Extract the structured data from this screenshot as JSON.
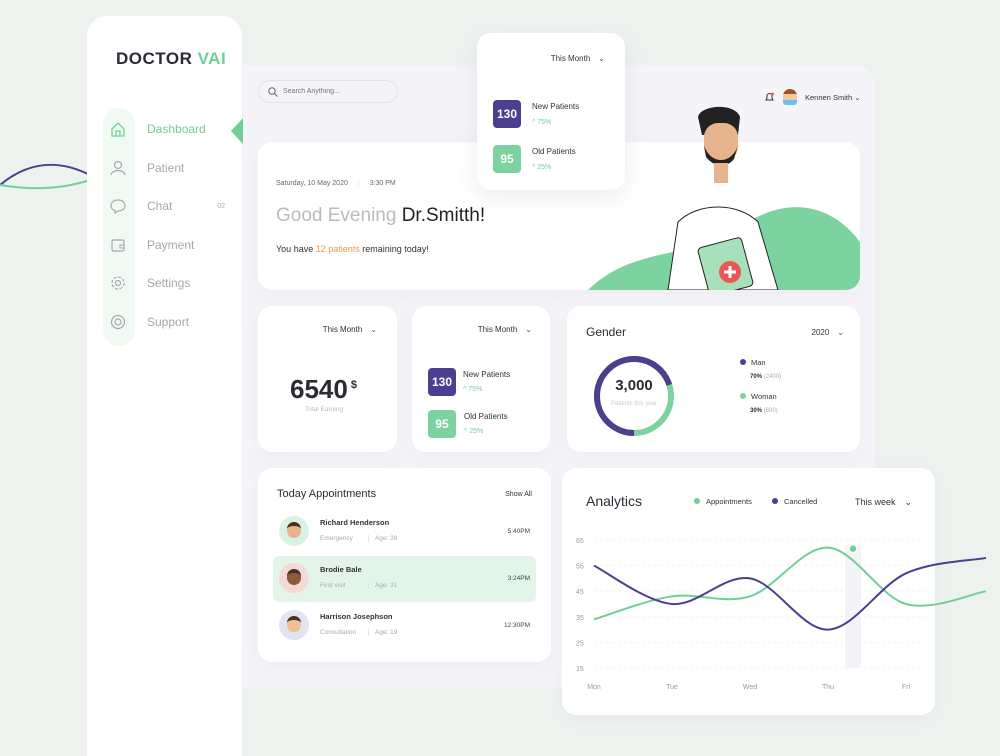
{
  "brand": {
    "name_part1": "DOCTOR",
    "name_part2": "VAI"
  },
  "sidebar": {
    "items": [
      {
        "label": "Dashboard",
        "icon": "home-icon",
        "active": true
      },
      {
        "label": "Patient",
        "icon": "user-icon"
      },
      {
        "label": "Chat",
        "icon": "chat-icon",
        "badge": "02"
      },
      {
        "label": "Payment",
        "icon": "wallet-icon"
      },
      {
        "label": "Settings",
        "icon": "gear-icon"
      },
      {
        "label": "Support",
        "icon": "lifebuoy-icon"
      }
    ]
  },
  "header": {
    "search_placeholder": "Search Anything...",
    "user_name": "Kennen Smith"
  },
  "floating_card": {
    "period": "This Month",
    "new_value": "130",
    "new_label": "New Patients",
    "new_pct": "75%",
    "old_value": "95",
    "old_label": "Old Patients",
    "old_pct": "25%"
  },
  "greeting": {
    "date": "Saturday, 10 May 2020",
    "time": "3:30 PM",
    "hello": "Good Evening ",
    "doctor": "Dr.Smitth!",
    "msg_pre": "You have ",
    "msg_highlight": "12 patients",
    "msg_post": " remaining today!"
  },
  "earning": {
    "period": "This Month",
    "value": "6540",
    "currency": "$",
    "label": "Total Earning"
  },
  "patients": {
    "period": "This Month",
    "new_value": "130",
    "new_label": "New Patients",
    "new_pct": "75%",
    "old_value": "95",
    "old_label": "Old Patients",
    "old_pct": "25%"
  },
  "gender": {
    "title": "Gender",
    "year": "2020",
    "total": "3,000",
    "total_label": "Patients this year",
    "man_label": "Man",
    "man_pct": "70%",
    "man_count": "(2400)",
    "woman_label": "Woman",
    "woman_pct": "30%",
    "woman_count": "(600)",
    "man_fraction": 0.7
  },
  "appointments": {
    "title": "Today Appointments",
    "show_all": "Show All",
    "items": [
      {
        "name": "Richard Henderson",
        "type": "Emergency",
        "age": "Age: 28",
        "time": "5:40PM"
      },
      {
        "name": "Brodie Bale",
        "type": "First visit",
        "age": "Age: 31",
        "time": "3:24PM",
        "highlight": true
      },
      {
        "name": "Harrison Josephson",
        "type": "Consultation",
        "age": "Age: 19",
        "time": "12:30PM"
      }
    ]
  },
  "colors": {
    "green": "#6fcf97",
    "purple": "#4b3f8f",
    "orange": "#f2994a"
  },
  "chart_data": {
    "type": "line",
    "title": "Analytics",
    "period": "This week",
    "categories": [
      "Mon",
      "Tue",
      "Wed",
      "Thu",
      "Fri"
    ],
    "yticks": [
      "65",
      "55",
      "45",
      "35",
      "25",
      "15"
    ],
    "ylim": [
      15,
      65
    ],
    "series": [
      {
        "name": "Appointments",
        "color": "#6fcf97",
        "values": [
          34,
          43,
          43,
          62,
          40
        ]
      },
      {
        "name": "Cancelled",
        "color": "#4b3f8f",
        "values": [
          55,
          40,
          50,
          30,
          52
        ]
      }
    ],
    "highlight": {
      "series": "Appointments",
      "category": "Thu"
    },
    "legend": "top"
  }
}
